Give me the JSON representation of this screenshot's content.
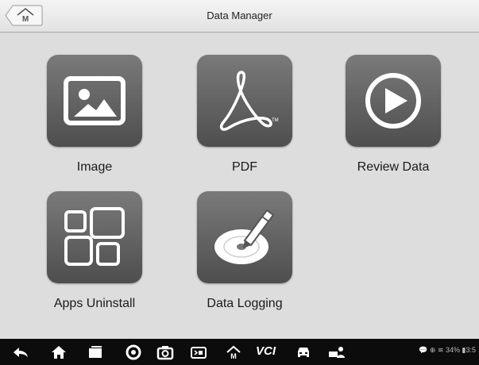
{
  "titlebar": {
    "title": "Data Manager",
    "home_icon": "home-M-icon"
  },
  "tiles": [
    {
      "label": "Image",
      "icon": "image-icon"
    },
    {
      "label": "PDF",
      "icon": "pdf-icon"
    },
    {
      "label": "Review Data",
      "icon": "play-icon"
    },
    {
      "label": "Apps Uninstall",
      "icon": "apps-grid-icon"
    },
    {
      "label": "Data Logging",
      "icon": "data-logging-icon"
    }
  ],
  "navbar": {
    "icons": [
      "back-icon",
      "home-icon",
      "recent-apps-icon",
      "browser-icon",
      "camera-icon",
      "display-mode-icon",
      "maxisys-home-icon",
      "vci-icon",
      "vehicle-icon",
      "remote-support-icon"
    ],
    "vci_label": "VCI",
    "status_text": "💬 ⊕ ≋ 34% ▮3:5"
  },
  "colors": {
    "tile_gradient_top": "#7a7a7a",
    "tile_gradient_bottom": "#4e4e4e",
    "content_bg": "#dddddd",
    "navbar_bg": "#0c0c0c"
  }
}
